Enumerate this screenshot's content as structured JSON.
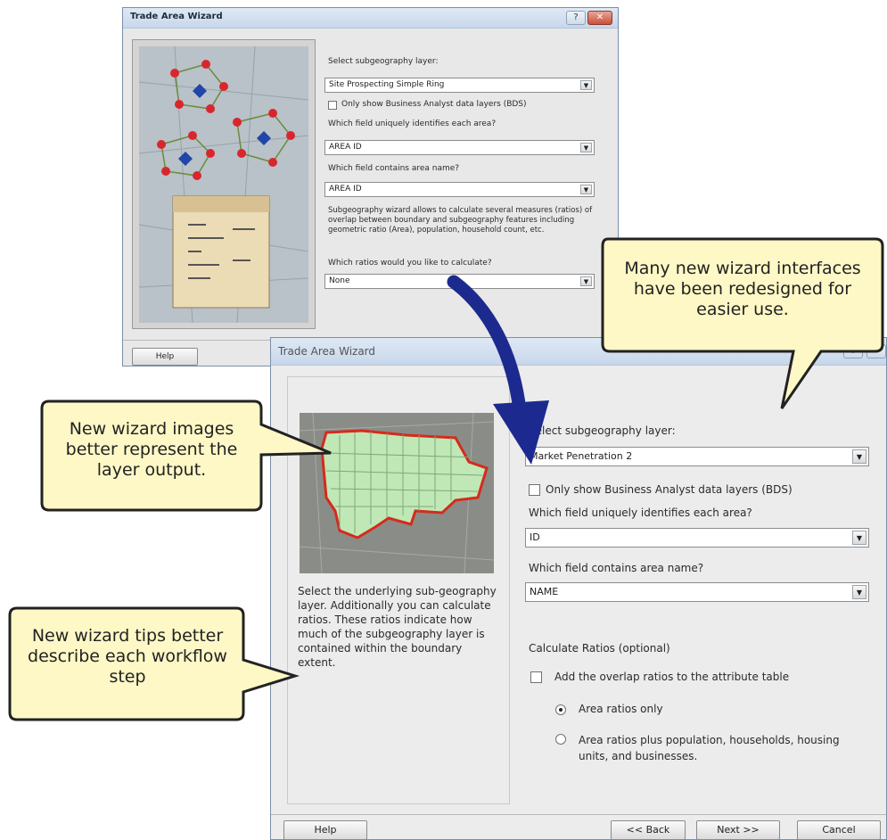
{
  "dialog_back": {
    "title": "Trade Area Wizard",
    "subgeo_label": "Select subgeography layer:",
    "subgeo_value": "Site Prospecting Simple Ring",
    "bds_label": "Only show Business Analyst data layers (BDS)",
    "id_field_label": "Which field uniquely identifies each area?",
    "id_field_value": "AREA ID",
    "name_field_label": "Which field contains area name?",
    "name_field_value": "AREA ID",
    "description": "Subgeography wizard allows to calculate several measures (ratios) of overlap between boundary and subgeography features including geometric ratio (Area), population, household count, etc.",
    "ratios_label": "Which ratios would you like to calculate?",
    "ratios_value": "None",
    "help_label": "Help"
  },
  "dialog_front": {
    "title": "Trade Area Wizard",
    "subgeo_label": "Select subgeography layer:",
    "subgeo_value": "Market Penetration 2",
    "bds_label": "Only show Business Analyst data layers (BDS)",
    "id_field_label": "Which field uniquely identifies each area?",
    "id_field_value": "ID",
    "name_field_label": "Which field contains area name?",
    "name_field_value": "NAME",
    "tip_text": "Select the underlying sub-geography layer. Additionally you can calculate ratios. These ratios indicate how much of the subgeography layer is contained within the boundary extent.",
    "ratios_header": "Calculate Ratios (optional)",
    "add_ratios_label": "Add the overlap ratios to the attribute table",
    "radio_area_only": "Area ratios only",
    "radio_area_plus": "Area ratios plus population, households, housing units, and businesses.",
    "help_label": "Help",
    "back_label": "<< Back",
    "next_label": "Next >>",
    "cancel_label": "Cancel"
  },
  "callouts": {
    "redesign": "Many new wizard interfaces have been redesigned for easier use.",
    "images": "New wizard images better represent the layer output.",
    "tips": "New wizard tips better describe each workflow step"
  },
  "icons": {
    "help_glyph": "?",
    "close_glyph": "✕",
    "dropdown_glyph": "▼"
  },
  "colors": {
    "callout_fill": "#fdf8c6",
    "arrow": "#1c2a8f",
    "map_highlight": "#d62a1c"
  }
}
